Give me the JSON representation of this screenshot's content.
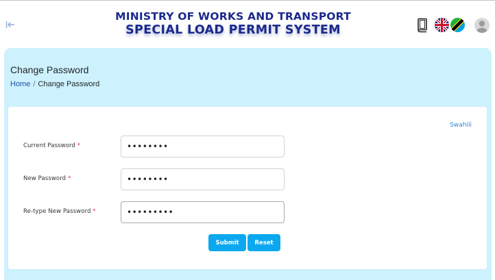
{
  "header": {
    "title_line1": "MINISTRY OF WORKS AND TRANSPORT",
    "title_line2": "SPECIAL LOAD PERMIT SYSTEM",
    "icons": [
      "collapse-sidebar-icon",
      "book-icon",
      "uk-flag-icon",
      "tanzania-flag-icon",
      "user-avatar-icon"
    ]
  },
  "page": {
    "title": "Change Password",
    "breadcrumb": {
      "home": "Home",
      "separator": "/",
      "current": "Change Password"
    }
  },
  "form": {
    "language_link": "Swahili",
    "fields": [
      {
        "label": "Current Password",
        "required_mark": "*",
        "value": "••••••••"
      },
      {
        "label": "New Password",
        "required_mark": "*",
        "value": "••••••••"
      },
      {
        "label": "Re-type New Password",
        "required_mark": "*",
        "value": "•••••••••"
      }
    ],
    "submit_label": "Submit",
    "reset_label": "Reset"
  },
  "colors": {
    "title": "#1b2a8c",
    "panel_bg": "#cdf1fd",
    "button": "#0ba8f0",
    "link": "#1b4fb0",
    "required": "#dc3545"
  }
}
